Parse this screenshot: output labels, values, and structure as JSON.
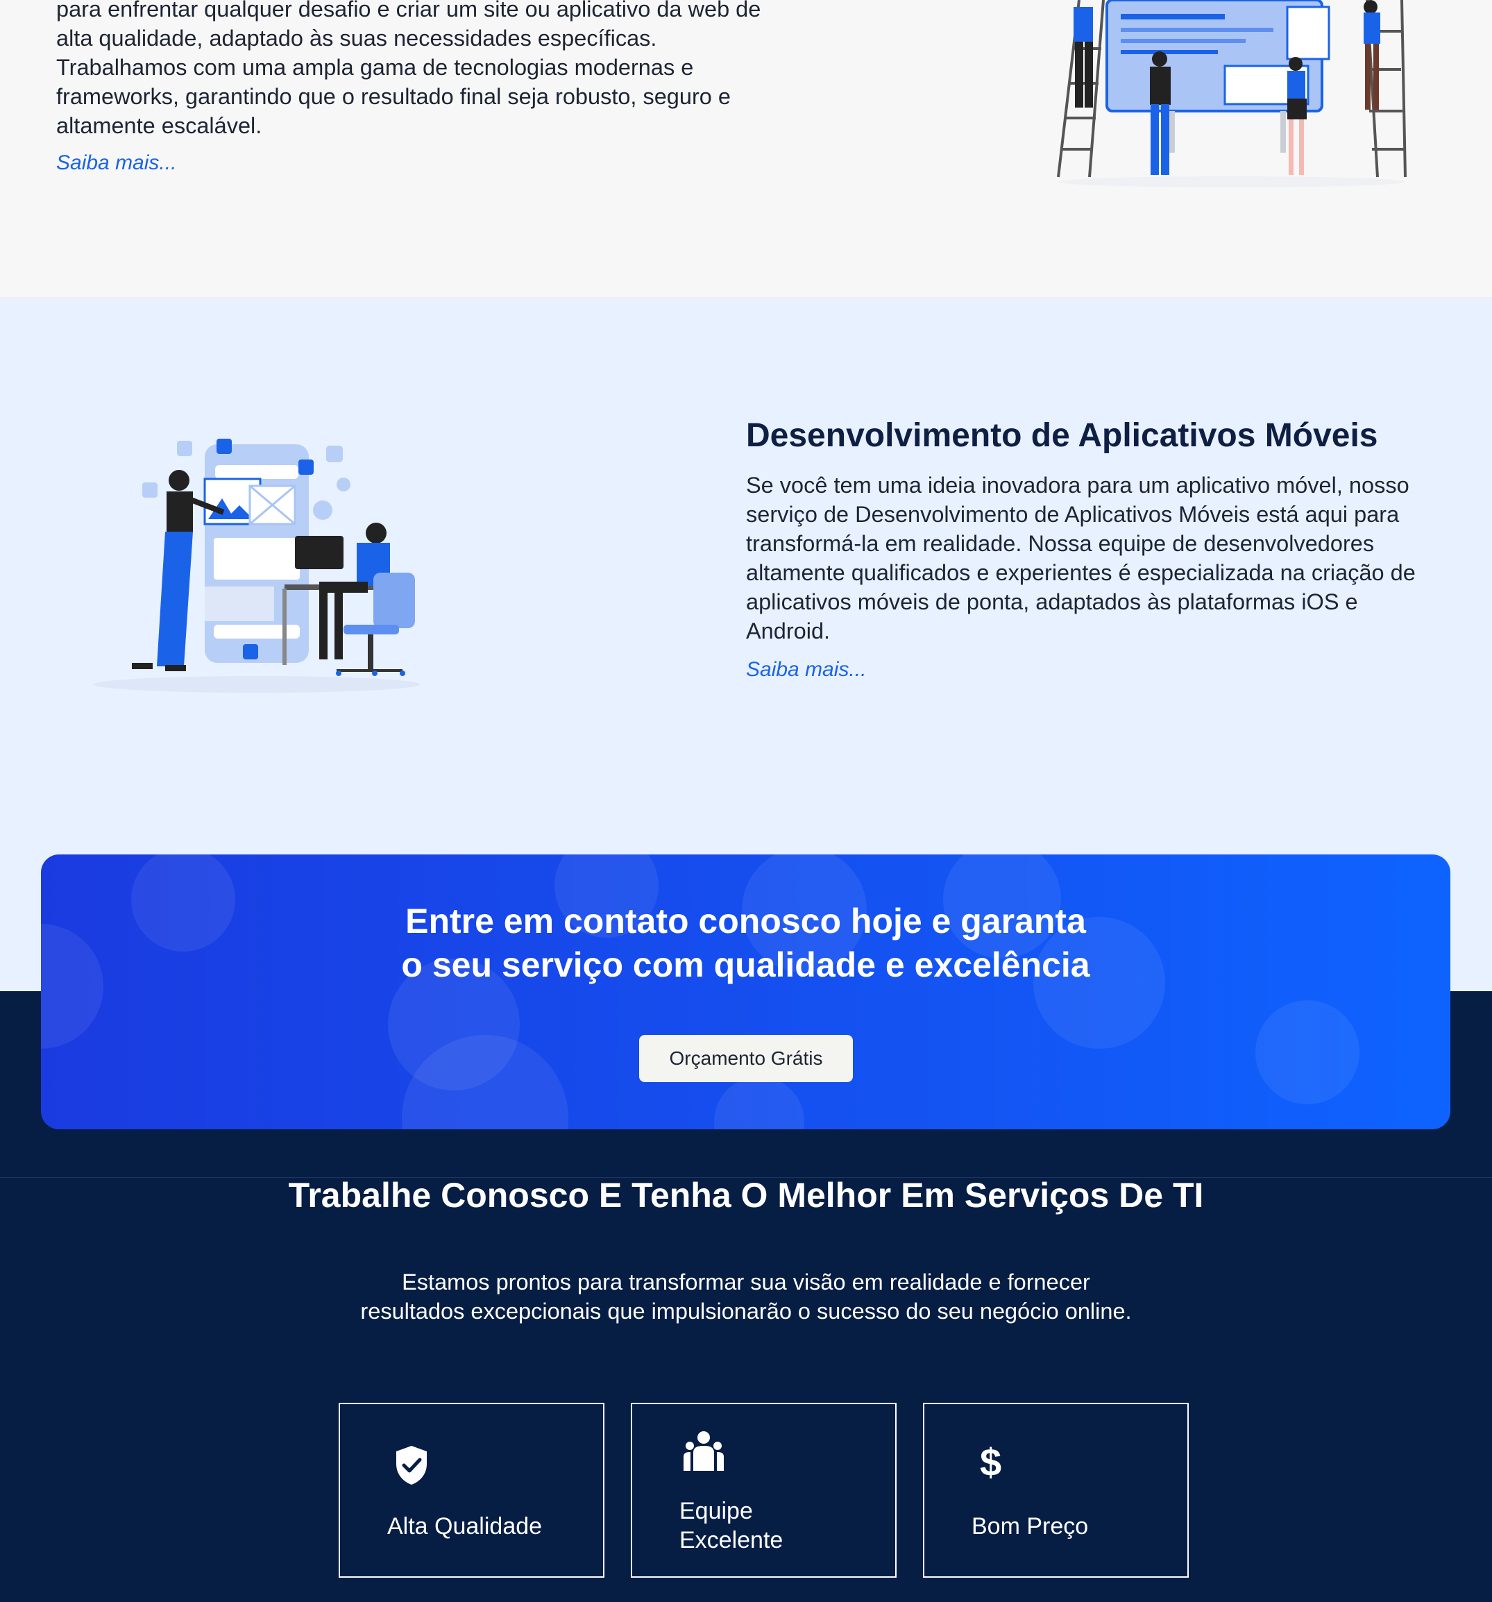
{
  "web_section": {
    "text": "para enfrentar qualquer desafio e criar um site ou aplicativo da web de alta qualidade, adaptado às suas necessidades específicas. Trabalhamos com uma ampla gama de tecnologias modernas e frameworks, garantindo que o resultado final seja robusto, seguro e altamente escalável.",
    "link": "Saiba mais..."
  },
  "mobile_section": {
    "title": "Desenvolvimento de Aplicativos Móveis",
    "text": "Se você tem uma ideia inovadora para um aplicativo móvel, nosso serviço de Desenvolvimento de Aplicativos Móveis está aqui para transformá-la em realidade. Nossa equipe de desenvolvedores altamente qualificados e experientes é especializada na criação de aplicativos móveis de ponta, adaptados às plataformas iOS e Android.",
    "link": "Saiba mais..."
  },
  "cta": {
    "title_line1": "Entre em contato conosco hoje e garanta",
    "title_line2": "o seu serviço com qualidade e excelência",
    "button": "Orçamento Grátis"
  },
  "work": {
    "title": "Trabalhe Conosco E Tenha O Melhor Em Serviços De TI",
    "text": "Estamos prontos para transformar sua visão em realidade e fornecer resultados excepcionais que impulsionarão o sucesso do seu negócio online.",
    "features": [
      {
        "icon": "shield-check-icon",
        "label": "Alta Qualidade"
      },
      {
        "icon": "team-icon",
        "label_line1": "Equipe",
        "label_line2": "Excelente"
      },
      {
        "icon": "dollar-icon",
        "label": "Bom Preço"
      }
    ]
  },
  "colors": {
    "accent": "#1a63e8",
    "dark_bg": "#061d44",
    "light_blue_bg": "#e8f1ff",
    "cta_gradient_start": "#1a3be0",
    "cta_gradient_end": "#0e63ff"
  }
}
